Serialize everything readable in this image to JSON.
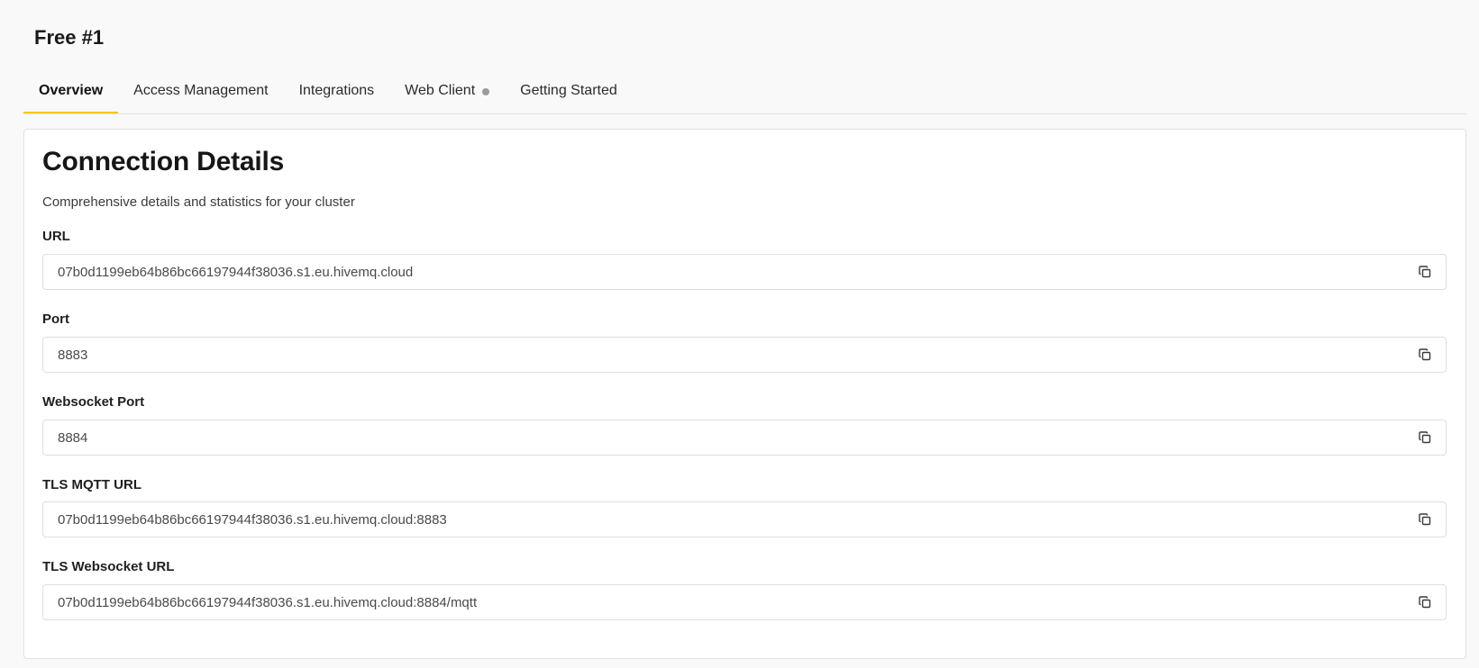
{
  "header": {
    "title": "Free #1"
  },
  "tabs": [
    {
      "label": "Overview",
      "active": true
    },
    {
      "label": "Access Management",
      "active": false
    },
    {
      "label": "Integrations",
      "active": false
    },
    {
      "label": "Web Client",
      "active": false,
      "status_dot": true
    },
    {
      "label": "Getting Started",
      "active": false
    }
  ],
  "card": {
    "title": "Connection Details",
    "subtitle": "Comprehensive details and statistics for your cluster",
    "fields": [
      {
        "label": "URL",
        "value": "07b0d1199eb64b86bc66197944f38036.s1.eu.hivemq.cloud",
        "icon": "copy-icon"
      },
      {
        "label": "Port",
        "value": "8883",
        "icon": "copy-icon"
      },
      {
        "label": "Websocket Port",
        "value": "8884",
        "icon": "copy-icon"
      },
      {
        "label": "TLS MQTT URL",
        "value": "07b0d1199eb64b86bc66197944f38036.s1.eu.hivemq.cloud:8883",
        "icon": "copy-icon"
      },
      {
        "label": "TLS Websocket URL",
        "value": "07b0d1199eb64b86bc66197944f38036.s1.eu.hivemq.cloud:8884/mqtt",
        "icon": "copy-icon"
      }
    ]
  },
  "colors": {
    "accent": "#f5c518",
    "status_dot": "#9b9b9b",
    "background": "#f9f9f9",
    "card_background": "#ffffff"
  }
}
